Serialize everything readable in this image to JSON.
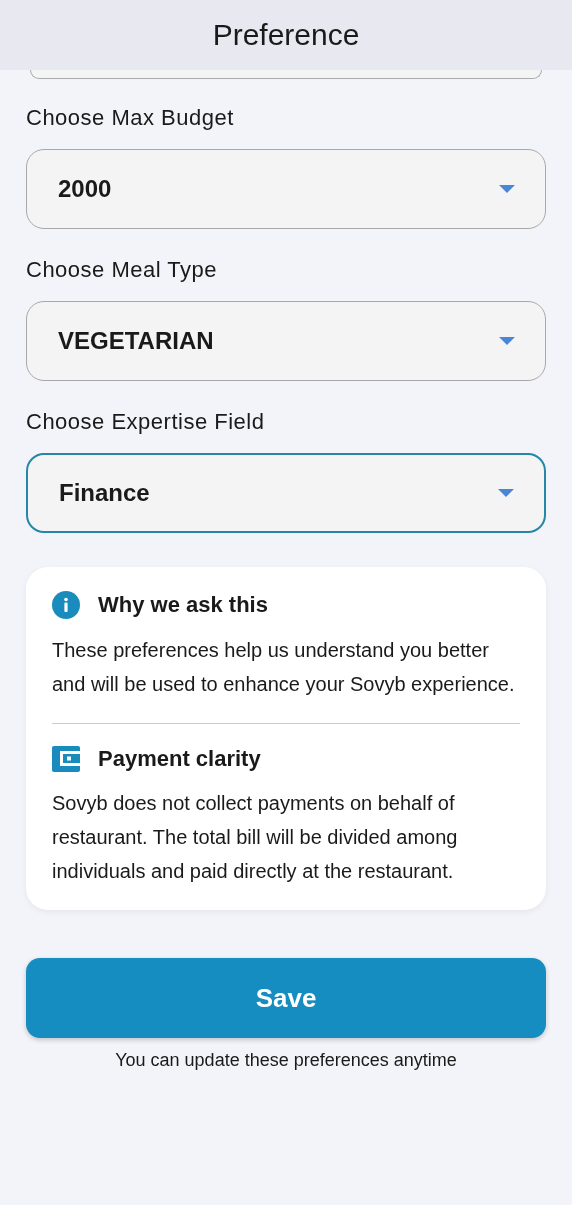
{
  "header": {
    "title": "Preference"
  },
  "fields": [
    {
      "label": "Choose Max Budget",
      "value": "2000",
      "focused": false
    },
    {
      "label": "Choose Meal Type",
      "value": "VEGETARIAN",
      "focused": false
    },
    {
      "label": "Choose Expertise Field",
      "value": "Finance",
      "focused": true
    }
  ],
  "info_card": {
    "sections": [
      {
        "kind": "info",
        "title": "Why we ask this",
        "text": "These preferences help us understand you better and will be used to enhance your Sovyb experience."
      },
      {
        "kind": "wallet",
        "title": "Payment clarity",
        "text": "Sovyb does not collect payments on behalf of restaurant. The total bill will be divided among individuals and paid directly at the restaurant."
      }
    ]
  },
  "save_button": {
    "label": "Save"
  },
  "footnote": "You can update these preferences anytime"
}
